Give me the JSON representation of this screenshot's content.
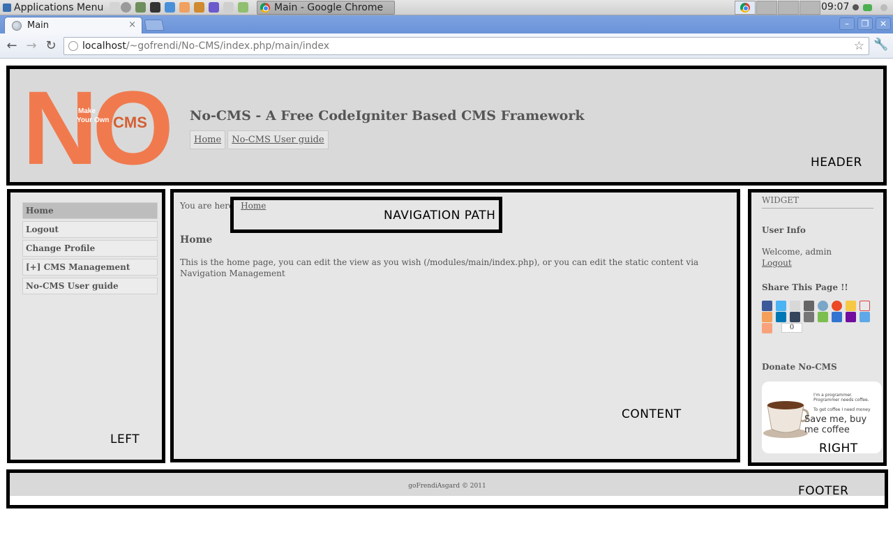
{
  "desktop": {
    "apps_menu": "Applications Menu",
    "taskbar_window": "Main - Google Chrome",
    "clock": "09:07"
  },
  "browser": {
    "tab_title": "Main",
    "tab_close": "×",
    "url_host": "localhost",
    "url_path": "/~gofrendi/No-CMS/index.php/main/index",
    "back": "←",
    "forward": "→",
    "reload": "↻",
    "bookmark_star": "☆",
    "wrench": "🔧",
    "window_controls": [
      "–",
      "❐",
      "✕"
    ]
  },
  "site": {
    "title": "No-CMS - A Free CodeIgniter Based CMS Framework",
    "logo": {
      "big": "NO",
      "small": "CMS",
      "tagline_1": "Make",
      "tagline_2": "Your Own"
    },
    "top_menu": [
      "Home",
      "No-CMS User guide"
    ],
    "header_label": "HEADER"
  },
  "left": {
    "items": [
      "Home",
      "Logout",
      "Change Profile",
      "[+]  CMS Management",
      "No-CMS User guide"
    ],
    "active_index": 0,
    "label": "LEFT"
  },
  "content": {
    "you_are_here": "You are here",
    "breadcrumb_home": "Home",
    "nav_path_label": "NAVIGATION PATH",
    "title": "Home",
    "text": "This is the home page, you can edit the view as you wish (/modules/main/index.php), or you can edit the static content via Navigation Management",
    "label": "CONTENT"
  },
  "right": {
    "widget_title": "WIDGET",
    "user_info_title": "User Info",
    "welcome": "Welcome, admin",
    "logout": "Logout",
    "share_title": "Share This Page !!",
    "share_count": "0",
    "donate_title": "Donate No-CMS",
    "donate_line1": "I'm a programmer. Programmer needs coffee.",
    "donate_line2": "To get coffee I need money",
    "donate_line3": "Save me, buy me coffee",
    "label": "RIGHT"
  },
  "footer": {
    "text": "goFrendiAsgard © 2011",
    "label": "FOOTER"
  },
  "colors": {
    "header_bg": "#d9d9d9",
    "panel_bg": "#e6e6e6",
    "logo_orange": "#f07a4e",
    "region_border": "#000000"
  }
}
